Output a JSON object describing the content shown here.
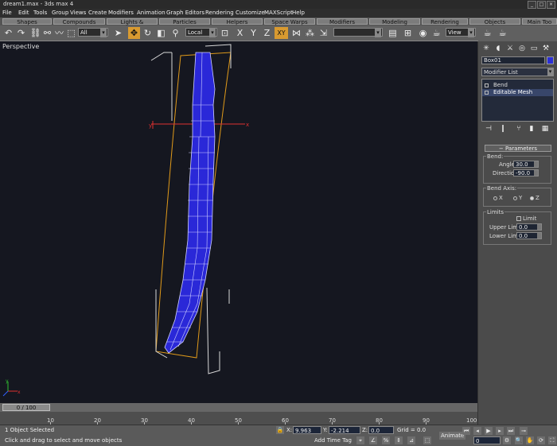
{
  "window": {
    "title": "dream1.max - 3ds max 4",
    "controls": [
      "_",
      "□",
      "×"
    ]
  },
  "menu": [
    "File",
    "Edit",
    "Tools",
    "Group",
    "Views",
    "Create",
    "Modifiers",
    "Animation",
    "Graph Editors",
    "Rendering",
    "Customize",
    "MAXScript",
    "Help"
  ],
  "tabs": [
    "Shapes",
    "Compounds",
    "Lights & Cameras",
    "Particles",
    "Helpers",
    "Space Warps",
    "Modifiers",
    "Modeling",
    "Rendering",
    "Objects",
    "Main Too"
  ],
  "toolbar": {
    "selection_filter": "All",
    "coord_system": "Local",
    "named_sel": "",
    "view_dropdown": "View",
    "axis_x": "X",
    "axis_y": "Y",
    "axis_z": "Z",
    "axis_xy": "XY"
  },
  "viewport": {
    "label": "Perspective",
    "gizmo_x": "x",
    "gizmo_y": "y",
    "axis_x": "x",
    "axis_y": "y"
  },
  "frame": {
    "indicator": "0 / 100"
  },
  "timeline": {
    "ticks": [
      "10",
      "20",
      "30",
      "40",
      "50",
      "60",
      "70",
      "80",
      "90",
      "100"
    ]
  },
  "status": {
    "selection": "1 Object Selected",
    "prompt": "Click and drag to select and move objects",
    "x_label": "X:",
    "x_value": "9.963",
    "y_label": "Y:",
    "y_value": "-2.214",
    "z_label": "Z:",
    "z_value": "0.0",
    "grid": "Grid = 0.0",
    "add_time_tag": "Add Time Tag",
    "animate": "Animate",
    "frame_value": "0"
  },
  "command_panel": {
    "object_name": "Box01",
    "object_color": "#2b2fd6",
    "modifier_list": "Modifier List",
    "stack": [
      {
        "label": "Bend",
        "selected": false
      },
      {
        "label": "Editable Mesh",
        "selected": true
      }
    ],
    "rollout_title": "Parameters",
    "bend": {
      "group": "Bend:",
      "angle_label": "Angle:",
      "angle": "30.0",
      "direction_label": "Direction:",
      "direction": "-90.0"
    },
    "bend_axis": {
      "group": "Bend Axis:",
      "options": [
        "X",
        "Y",
        "Z"
      ],
      "selected": "Z"
    },
    "limits": {
      "group": "Limits",
      "limit_effect": "Limit",
      "upper_label": "Upper Limit:",
      "upper": "0.0",
      "lower_label": "Lower Limit:",
      "lower": "0.0"
    }
  }
}
